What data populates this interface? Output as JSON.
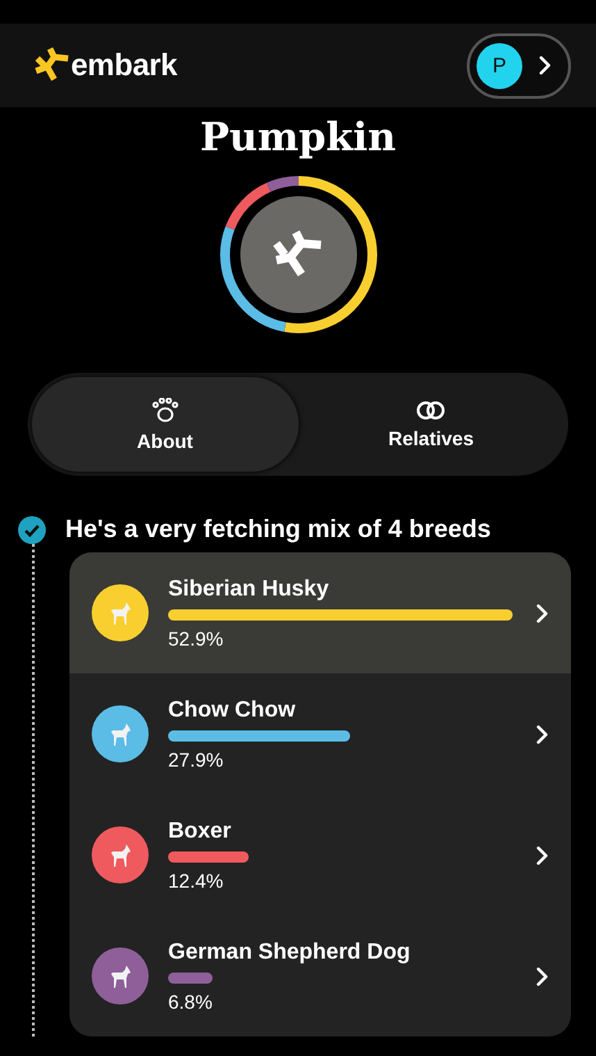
{
  "header": {
    "logo_text": "embark",
    "profile": {
      "initial": "P"
    }
  },
  "dog_name": "Pumpkin",
  "tabs": [
    {
      "label": "About",
      "selected": true,
      "kind": "paw"
    },
    {
      "label": "Relatives",
      "selected": false,
      "kind": "rings"
    }
  ],
  "mix": {
    "heading": "He's a very fetching mix of 4 breeds",
    "done": true
  },
  "breeds": [
    {
      "name": "Siberian Husky",
      "percent": "52.9%",
      "color": "#f9cf2f",
      "selected": true
    },
    {
      "name": "Chow Chow",
      "percent": "27.9%",
      "color": "#5bbce6",
      "selected": false
    },
    {
      "name": "Boxer",
      "percent": "12.4%",
      "color": "#ef5a5f",
      "selected": false
    },
    {
      "name": "German Shepherd Dog",
      "percent": "6.8%",
      "color": "#8f5f9a",
      "selected": false
    }
  ]
}
